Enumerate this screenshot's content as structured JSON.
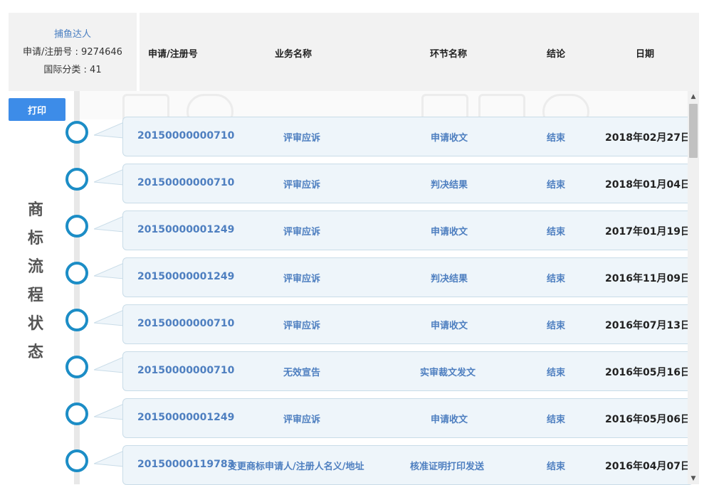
{
  "info": {
    "name": "捕鱼达人",
    "reg_line": "申请/注册号 : 9274646",
    "class_line": "国际分类 : 41"
  },
  "header": {
    "col_number": "申请/注册号",
    "col_business": "业务名称",
    "col_step": "环节名称",
    "col_result": "结论",
    "col_date": "日期"
  },
  "print_label": "打印",
  "side_title": [
    "商",
    "标",
    "流",
    "程",
    "状",
    "态"
  ],
  "rows": [
    {
      "number": "20150000000710",
      "business": "评审应诉",
      "step": "申请收文",
      "result": "结束",
      "date": "2018年02月27日"
    },
    {
      "number": "20150000000710",
      "business": "评审应诉",
      "step": "判决结果",
      "result": "结束",
      "date": "2018年01月04日"
    },
    {
      "number": "20150000001249",
      "business": "评审应诉",
      "step": "申请收文",
      "result": "结束",
      "date": "2017年01月19日"
    },
    {
      "number": "20150000001249",
      "business": "评审应诉",
      "step": "判决结果",
      "result": "结束",
      "date": "2016年11月09日"
    },
    {
      "number": "20150000000710",
      "business": "评审应诉",
      "step": "申请收文",
      "result": "结束",
      "date": "2016年07月13日"
    },
    {
      "number": "20150000000710",
      "business": "无效宣告",
      "step": "实审裁文发文",
      "result": "结束",
      "date": "2016年05月16日"
    },
    {
      "number": "20150000001249",
      "business": "评审应诉",
      "step": "申请收文",
      "result": "结束",
      "date": "2016年05月06日"
    },
    {
      "number": "20150000119783",
      "business": "变更商标申请人/注册人名义/地址",
      "step": "核准证明打印发送",
      "result": "结束",
      "date": "2016年04月07日"
    }
  ],
  "colors": {
    "accent": "#3d8ce8",
    "timeline_circle": "#1c8dc6",
    "row_bg": "#eef5fa",
    "link_text": "#4e7fc0"
  }
}
